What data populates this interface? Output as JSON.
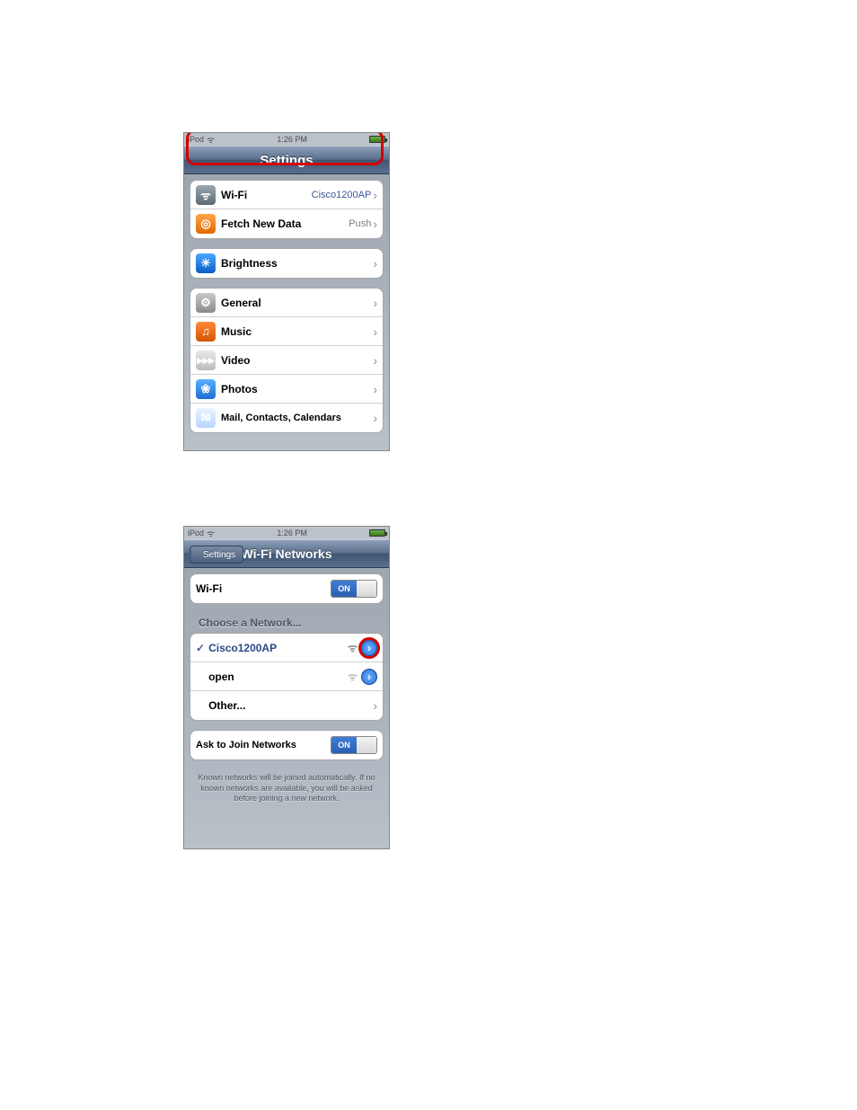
{
  "shot1": {
    "status": {
      "carrier": "iPod",
      "time": "1:26 PM"
    },
    "title": "Settings",
    "group1": [
      {
        "label": "Wi-Fi",
        "value": "Cisco1200AP"
      },
      {
        "label": "Fetch New Data",
        "value": "Push"
      }
    ],
    "group2": [
      {
        "label": "Brightness"
      }
    ],
    "group3": [
      {
        "label": "General"
      },
      {
        "label": "Music"
      },
      {
        "label": "Video"
      },
      {
        "label": "Photos"
      },
      {
        "label": "Mail, Contacts, Calendars"
      }
    ]
  },
  "shot2": {
    "status": {
      "carrier": "iPod",
      "time": "1:26 PM"
    },
    "back": "Settings",
    "title": "Wi-Fi Networks",
    "wifi_row": {
      "label": "Wi-Fi",
      "state": "ON"
    },
    "choose_header": "Choose a Network...",
    "networks": [
      {
        "name": "Cisco1200AP",
        "connected": true
      },
      {
        "name": "open",
        "connected": false
      }
    ],
    "other": "Other...",
    "ask_row": {
      "label": "Ask to Join Networks",
      "state": "ON"
    },
    "footer": "Known networks will be joined automatically. If no known networks are available, you will be asked before joining a new network."
  }
}
